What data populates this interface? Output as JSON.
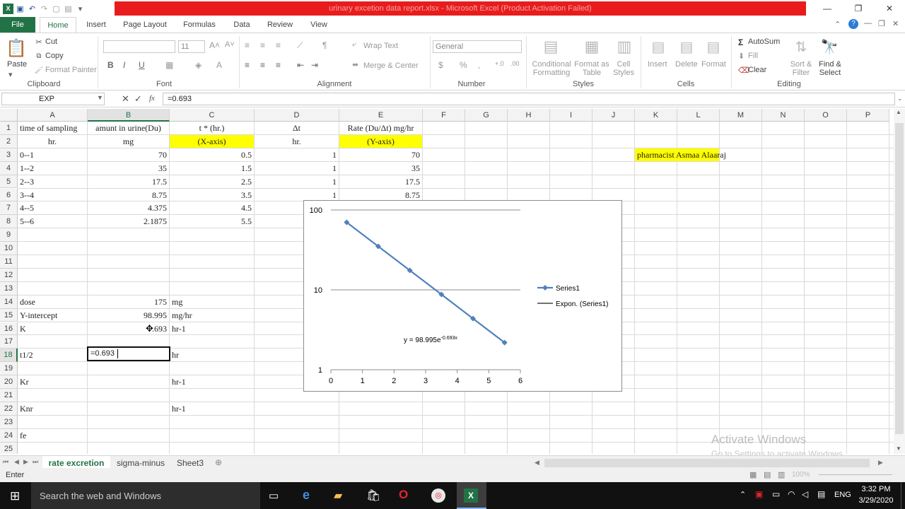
{
  "window": {
    "title": "urinary excetion data report.xlsx - Microsoft Excel (Product Activation Failed)"
  },
  "ribbon_tabs": [
    "File",
    "Home",
    "Insert",
    "Page Layout",
    "Formulas",
    "Data",
    "Review",
    "View"
  ],
  "ribbon": {
    "clipboard": {
      "paste": "Paste",
      "cut": "Cut",
      "copy": "Copy",
      "format_painter": "Format Painter",
      "label": "Clipboard"
    },
    "font": {
      "size": "11",
      "label": "Font",
      "bold": "B",
      "italic": "I",
      "underline": "U"
    },
    "alignment": {
      "wrap": "Wrap Text",
      "merge": "Merge & Center",
      "label": "Alignment"
    },
    "number": {
      "format": "General",
      "currency": "$",
      "percent": "%",
      "comma": ",",
      "label": "Number"
    },
    "styles": {
      "conditional": "Conditional Formatting",
      "format_table": "Format as Table",
      "cell_styles": "Cell Styles",
      "label": "Styles"
    },
    "cells": {
      "insert": "Insert",
      "delete": "Delete",
      "format": "Format",
      "label": "Cells"
    },
    "editing": {
      "autosum": "AutoSum",
      "fill": "Fill",
      "clear": "Clear",
      "sort": "Sort & Filter",
      "find": "Find & Select",
      "label": "Editing"
    }
  },
  "formula_bar": {
    "name_box": "EXP",
    "fx": "fx",
    "formula": "=0.693"
  },
  "columns": [
    "A",
    "B",
    "C",
    "D",
    "E",
    "F",
    "G",
    "H",
    "I",
    "J",
    "K",
    "L",
    "M",
    "N",
    "O",
    "P"
  ],
  "rows": [
    "1",
    "2",
    "3",
    "4",
    "5",
    "6",
    "7",
    "8",
    "9",
    "10",
    "11",
    "12",
    "13",
    "14",
    "15",
    "16",
    "17",
    "18",
    "19",
    "20",
    "21",
    "22",
    "23",
    "24",
    "25"
  ],
  "cells": {
    "A1": "time of sampling",
    "B1": "amunt in urine(Du)",
    "C1": "t * (hr.)",
    "D1": "Δt",
    "E1": "Rate (Du/Δt) mg/hr",
    "A2": "hr.",
    "B2": "mg",
    "C2": "(X-axis)",
    "D2": "hr.",
    "E2": "(Y-axis)",
    "A3": "0--1",
    "B3": "70",
    "C3": "0.5",
    "D3": "1",
    "E3": "70",
    "A4": "1--2",
    "B4": "35",
    "C4": "1.5",
    "D4": "1",
    "E4": "35",
    "A5": "2--3",
    "B5": "17.5",
    "C5": "2.5",
    "D5": "1",
    "E5": "17.5",
    "A6": "3--4",
    "B6": "8.75",
    "C6": "3.5",
    "D6": "1",
    "E6": "8.75",
    "A7": "4--5",
    "B7": "4.375",
    "C7": "4.5",
    "A8": "5--6",
    "B8": "2.1875",
    "C8": "5.5",
    "A14": "dose",
    "B14": "175",
    "C14": "mg",
    "A15": "Y-intercept",
    "B15": "98.995",
    "C15": "mg/hr",
    "A16": "K",
    "B16": ".693",
    "C16": "hr-1",
    "A18": "t1/2",
    "B18": "=0.693",
    "C18": "hr",
    "A20": "Kr",
    "C20": "hr-1",
    "A22": "Knr",
    "C22": "hr-1",
    "A24": "fe",
    "K3": "pharmacist Asmaa Alaaraj"
  },
  "chart_data": {
    "type": "scatter",
    "x": [
      0.5,
      1.5,
      2.5,
      3.5,
      4.5,
      5.5
    ],
    "series": [
      {
        "name": "Series1",
        "values": [
          70,
          35,
          17.5,
          8.75,
          4.375,
          2.1875
        ]
      }
    ],
    "trendline": {
      "name": "Expon. (Series1)",
      "equation": "y = 98.995e",
      "exponent": "-0.693x",
      "a": 98.995,
      "b": -0.693
    },
    "xlim": [
      0,
      6
    ],
    "ylim": [
      1,
      100
    ],
    "yscale": "log",
    "x_ticks": [
      "0",
      "1",
      "2",
      "3",
      "4",
      "5",
      "6"
    ],
    "y_ticks": [
      "100",
      "10",
      "1"
    ],
    "legend_position": "right",
    "colors": {
      "series": "#4f81bd",
      "trend": "#1f1f1f"
    }
  },
  "sheets": [
    "rate excretion",
    "sigma-minus",
    "Sheet3"
  ],
  "status": {
    "mode": "Enter",
    "zoom": "100%"
  },
  "watermark": {
    "line1": "Activate Windows",
    "line2": "Go to Settings to activate Windows."
  },
  "taskbar": {
    "search": "Search the web and Windows",
    "lang": "ENG",
    "time": "3:32 PM",
    "date": "3/29/2020"
  }
}
